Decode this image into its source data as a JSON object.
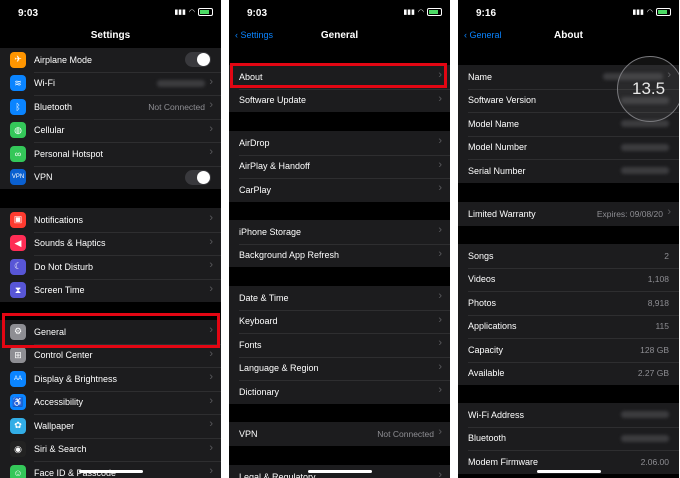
{
  "settings": {
    "time": "9:03",
    "title": "Settings",
    "group1": [
      {
        "label": "Airplane Mode",
        "icon": "airplane-icon",
        "color": "#ff9500",
        "glyph": "✈",
        "toggle": true
      },
      {
        "label": "Wi-Fi",
        "icon": "wifi-icon",
        "color": "#0a84ff",
        "glyph": "≋",
        "blurred": true
      },
      {
        "label": "Bluetooth",
        "icon": "bluetooth-icon",
        "color": "#0a84ff",
        "glyph": "ᛒ",
        "value": "Not Connected"
      },
      {
        "label": "Cellular",
        "icon": "cellular-icon",
        "color": "#34c759",
        "glyph": "◍"
      },
      {
        "label": "Personal Hotspot",
        "icon": "hotspot-icon",
        "color": "#34c759",
        "glyph": "∞"
      },
      {
        "label": "VPN",
        "icon": "vpn-icon",
        "color": "#0a60d0",
        "glyph": "VPN",
        "toggle": true
      }
    ],
    "group2": [
      {
        "label": "Notifications",
        "icon": "notifications-icon",
        "color": "#ff3b30",
        "glyph": "▣"
      },
      {
        "label": "Sounds & Haptics",
        "icon": "sounds-icon",
        "color": "#ff2d55",
        "glyph": "◀"
      },
      {
        "label": "Do Not Disturb",
        "icon": "moon-icon",
        "color": "#5856d6",
        "glyph": "☾"
      },
      {
        "label": "Screen Time",
        "icon": "hourglass-icon",
        "color": "#5856d6",
        "glyph": "⧗"
      }
    ],
    "group3": [
      {
        "label": "General",
        "icon": "gear-icon",
        "color": "#8e8e93",
        "glyph": "⚙"
      },
      {
        "label": "Control Center",
        "icon": "control-center-icon",
        "color": "#8e8e93",
        "glyph": "⊞"
      },
      {
        "label": "Display & Brightness",
        "icon": "display-icon",
        "color": "#0a84ff",
        "glyph": "AA"
      },
      {
        "label": "Accessibility",
        "icon": "accessibility-icon",
        "color": "#0a84ff",
        "glyph": "♿"
      },
      {
        "label": "Wallpaper",
        "icon": "wallpaper-icon",
        "color": "#32ade6",
        "glyph": "✿"
      },
      {
        "label": "Siri & Search",
        "icon": "siri-icon",
        "color": "#222222",
        "glyph": "◉"
      },
      {
        "label": "Face ID & Passcode",
        "icon": "faceid-icon",
        "color": "#34c759",
        "glyph": "☺"
      }
    ]
  },
  "general": {
    "time": "9:03",
    "back_label": "Settings",
    "title": "General",
    "group1": [
      {
        "label": "About"
      },
      {
        "label": "Software Update"
      }
    ],
    "group2": [
      {
        "label": "AirDrop"
      },
      {
        "label": "AirPlay & Handoff"
      },
      {
        "label": "CarPlay"
      }
    ],
    "group3": [
      {
        "label": "iPhone Storage"
      },
      {
        "label": "Background App Refresh"
      }
    ],
    "group4": [
      {
        "label": "Date & Time"
      },
      {
        "label": "Keyboard"
      },
      {
        "label": "Fonts"
      },
      {
        "label": "Language & Region"
      },
      {
        "label": "Dictionary"
      }
    ],
    "group5": [
      {
        "label": "VPN",
        "value": "Not Connected"
      }
    ],
    "group6": [
      {
        "label": "Legal & Regulatory"
      }
    ]
  },
  "about": {
    "time": "9:16",
    "back_label": "General",
    "title": "About",
    "version_badge": "13.5",
    "group1": [
      {
        "label": "Name",
        "blurred": true,
        "chevron": true
      },
      {
        "label": "Software Version",
        "blurred": true
      },
      {
        "label": "Model Name",
        "blurred": true
      },
      {
        "label": "Model Number",
        "blurred": true
      },
      {
        "label": "Serial Number",
        "blurred": true
      }
    ],
    "group2": [
      {
        "label": "Limited Warranty",
        "value": "Expires: 09/08/20",
        "chevron": true
      }
    ],
    "group3": [
      {
        "label": "Songs",
        "value": "2"
      },
      {
        "label": "Videos",
        "value": "1,108"
      },
      {
        "label": "Photos",
        "value": "8,918"
      },
      {
        "label": "Applications",
        "value": "115"
      },
      {
        "label": "Capacity",
        "value": "128 GB"
      },
      {
        "label": "Available",
        "value": "2.27 GB"
      }
    ],
    "group4": [
      {
        "label": "Wi-Fi Address",
        "blurred": true
      },
      {
        "label": "Bluetooth",
        "blurred": true
      },
      {
        "label": "Modem Firmware",
        "value": "2.06.00"
      }
    ]
  },
  "colors": {
    "highlight": "#e30613",
    "accent": "#0a84ff",
    "background": "#000000",
    "cell": "#1c1c1e"
  }
}
